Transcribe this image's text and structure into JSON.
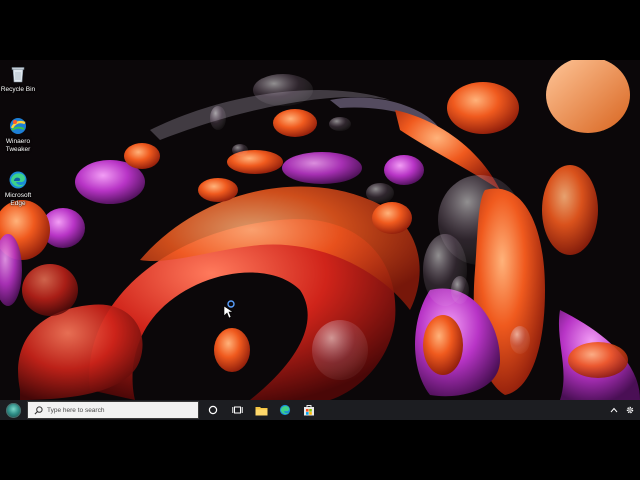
{
  "desktop": {
    "icons": [
      {
        "label": "Recycle Bin",
        "icon": "recycle-bin-icon"
      },
      {
        "label": "Winaero\nTweaker",
        "icon": "winaero-tweaker-icon"
      },
      {
        "label": "Microsoft\nEdge",
        "icon": "edge-icon"
      }
    ]
  },
  "taskbar": {
    "start_icon": "windows-start-orb-icon",
    "search_placeholder": "Type here to search",
    "buttons": [
      "cortana-icon",
      "task-view-icon",
      "file-explorer-icon",
      "edge-icon",
      "store-icon"
    ],
    "tray": [
      "show-hidden-icons-chevron-icon",
      "settings-gear-icon"
    ]
  },
  "colors": {
    "taskbar": "#1c1d21",
    "search_box": "#f2f2f2",
    "wallpaper_bg": "#0b0709",
    "wallpaper_orange": "#e8521c",
    "wallpaper_magenta": "#c93fd0"
  }
}
